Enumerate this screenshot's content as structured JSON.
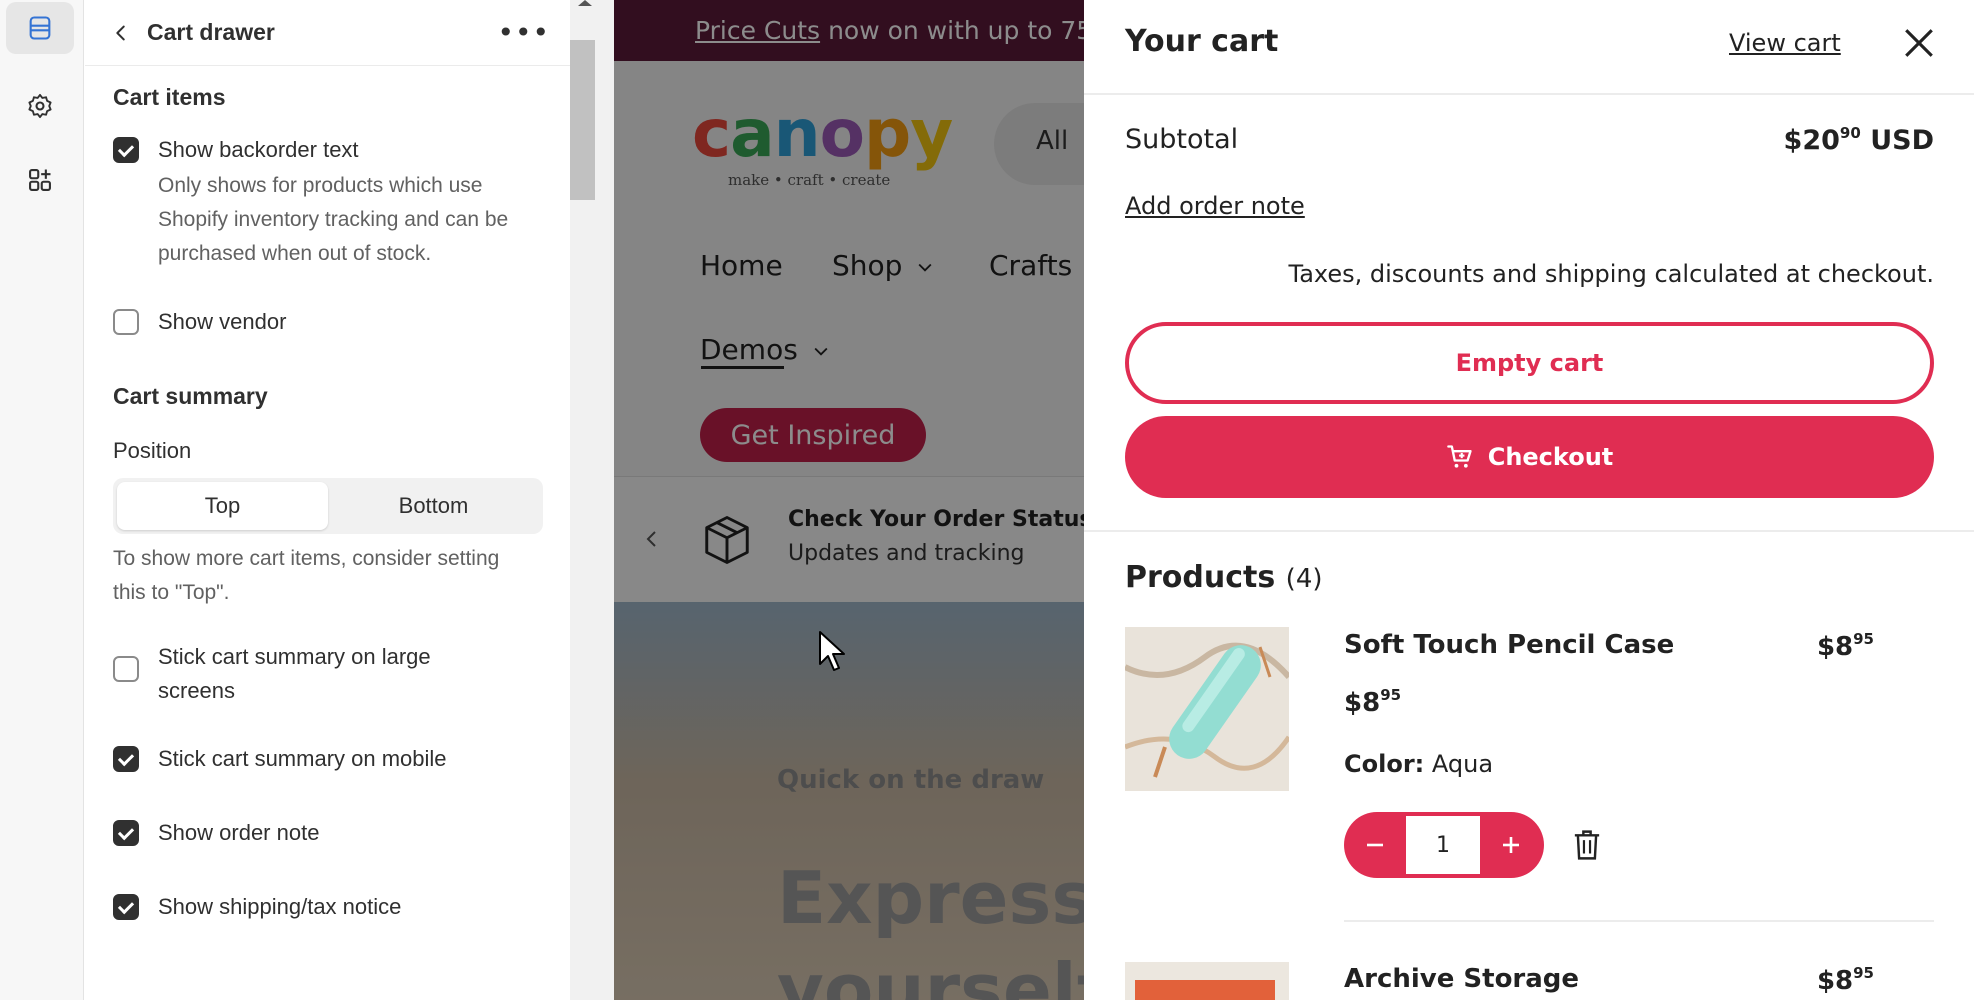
{
  "rail": {
    "items": [
      {
        "icon": "sections-icon",
        "active": true
      },
      {
        "icon": "gear-icon",
        "active": false
      },
      {
        "icon": "apps-icon",
        "active": false
      }
    ]
  },
  "panel": {
    "title": "Cart drawer",
    "more": "•••",
    "cart_items": {
      "heading": "Cart items",
      "show_backorder": {
        "label": "Show backorder text",
        "checked": true
      },
      "backorder_help": "Only shows for products which use Shopify inventory tracking and can be purchased when out of stock.",
      "show_vendor": {
        "label": "Show vendor",
        "checked": false
      }
    },
    "cart_summary": {
      "heading": "Cart summary",
      "position_label": "Position",
      "position_options": [
        "Top",
        "Bottom"
      ],
      "position_selected": "Top",
      "position_help": "To show more cart items, consider setting this to \"Top\".",
      "stick_large": {
        "label": "Stick cart summary on large screens",
        "checked": false
      },
      "stick_mobile": {
        "label": "Stick cart summary on mobile",
        "checked": true
      },
      "order_note": {
        "label": "Show order note",
        "checked": true
      },
      "tax_notice": {
        "label": "Show shipping/tax notice",
        "checked": true
      }
    }
  },
  "preview": {
    "announcement_link": "Price Cuts",
    "announcement_text": "now on with up to 75",
    "logo": {
      "word": "canopy",
      "tagline": "make • craft • create"
    },
    "search_label": "All",
    "nav": {
      "home": "Home",
      "shop": "Shop",
      "crafts": "Crafts",
      "demos": "Demos"
    },
    "cta": "Get Inspired",
    "order_status": {
      "title": "Check Your Order Status",
      "subtitle": "Updates and tracking"
    },
    "hero": {
      "kicker": "Quick on the draw",
      "headline_1": "Express",
      "headline_2": "yourself"
    }
  },
  "cart": {
    "title": "Your cart",
    "view_cart": "View cart",
    "subtotal_label": "Subtotal",
    "subtotal_main": "$20",
    "subtotal_cents": "90",
    "subtotal_currency": "USD",
    "add_order_note": "Add order note",
    "tax_note": "Taxes, discounts and shipping calculated at checkout.",
    "empty_cart": "Empty cart",
    "checkout": "Checkout",
    "products_label": "Products",
    "products_count": "(4)",
    "items": [
      {
        "name": "Soft Touch Pencil Case",
        "price_main": "$8",
        "price_cents": "95",
        "unit_main": "$8",
        "unit_cents": "95",
        "color_label": "Color:",
        "color_value": "Aqua",
        "quantity": "1"
      },
      {
        "name": "Archive Storage",
        "price_main": "$8",
        "price_cents": "95"
      }
    ]
  },
  "colors": {
    "accent": "#e02d52",
    "announcement_bg": "#5c1a3a",
    "cta_bg": "#c02049"
  }
}
